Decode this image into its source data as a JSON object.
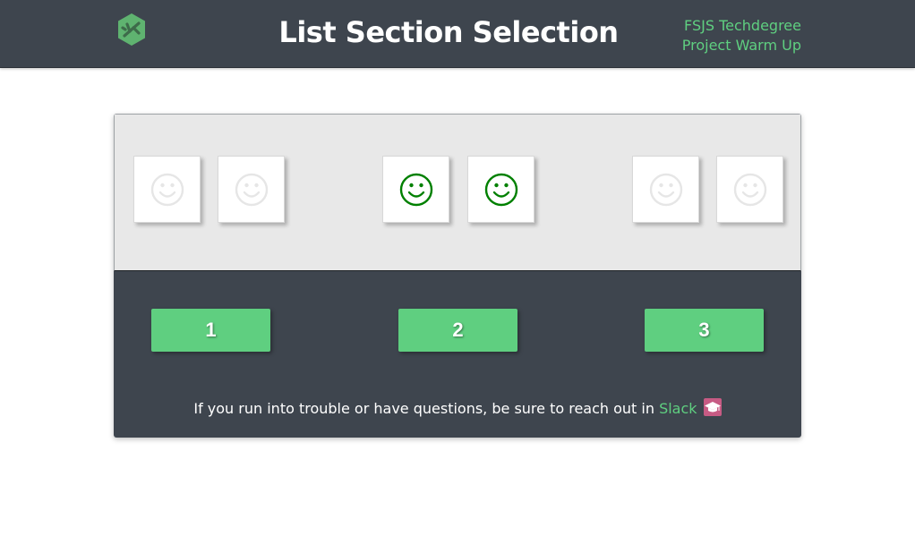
{
  "header": {
    "title": "List Section Selection",
    "line1": "FSJS Techdegree",
    "line2": "Project Warm Up",
    "logo_icon": "treehouse-logo-icon"
  },
  "tiles": [
    {
      "icon": "smiley-icon",
      "active": false
    },
    {
      "icon": "smiley-icon",
      "active": false
    },
    {
      "icon": "smiley-icon",
      "active": true
    },
    {
      "icon": "smiley-icon",
      "active": true
    },
    {
      "icon": "smiley-icon",
      "active": false
    },
    {
      "icon": "smiley-icon",
      "active": false
    }
  ],
  "buttons": [
    "1",
    "2",
    "3"
  ],
  "footer": {
    "text": "If you run into trouble or have questions, be sure to reach out in ",
    "link": "Slack",
    "icon": "graduation-cap-icon"
  },
  "colors": {
    "header_bg": "#3e454e",
    "accent_green": "#5fcf80",
    "smiley_active": "#008000",
    "smiley_inactive": "#e6e6e6",
    "panel_bg": "#e8e8e8",
    "cap_badge": "#c75b84"
  }
}
